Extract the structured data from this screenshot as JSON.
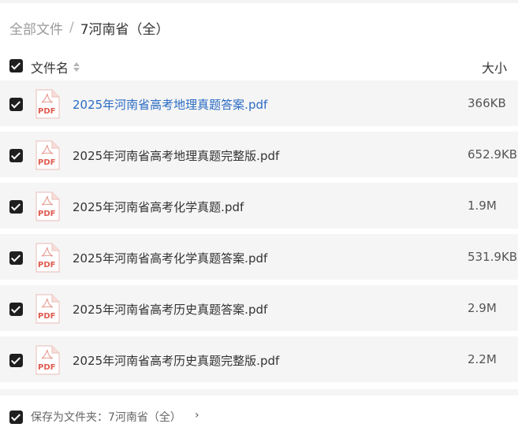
{
  "breadcrumb": {
    "root": "全部文件",
    "separator": "/",
    "current": "7河南省（全）"
  },
  "header": {
    "name_label": "文件名",
    "size_label": "大小",
    "all_checked": true
  },
  "files": [
    {
      "name": "2025年河南省高考地理真题答案.pdf",
      "size": "366KB",
      "checked": true,
      "highlighted": true,
      "icon": "pdf-icon"
    },
    {
      "name": "2025年河南省高考地理真题完整版.pdf",
      "size": "652.9KB",
      "checked": true,
      "highlighted": false,
      "icon": "pdf-icon"
    },
    {
      "name": "2025年河南省高考化学真题.pdf",
      "size": "1.9M",
      "checked": true,
      "highlighted": false,
      "icon": "pdf-icon"
    },
    {
      "name": "2025年河南省高考化学真题答案.pdf",
      "size": "531.9KB",
      "checked": true,
      "highlighted": false,
      "icon": "pdf-icon"
    },
    {
      "name": "2025年河南省高考历史真题答案.pdf",
      "size": "2.9M",
      "checked": true,
      "highlighted": false,
      "icon": "pdf-icon"
    },
    {
      "name": "2025年河南省高考历史真题完整版.pdf",
      "size": "2.2M",
      "checked": true,
      "highlighted": false,
      "icon": "pdf-icon"
    }
  ],
  "pdf_icon_label": "PDF",
  "footer": {
    "save_text": "保存为文件夹：7河南省（全）",
    "chevron": "›"
  },
  "colors": {
    "link": "#2b6cc4",
    "row_bg": "#f5f5f5",
    "pdf_red": "#e05a4f",
    "checkbox": "#1f1f1f"
  }
}
